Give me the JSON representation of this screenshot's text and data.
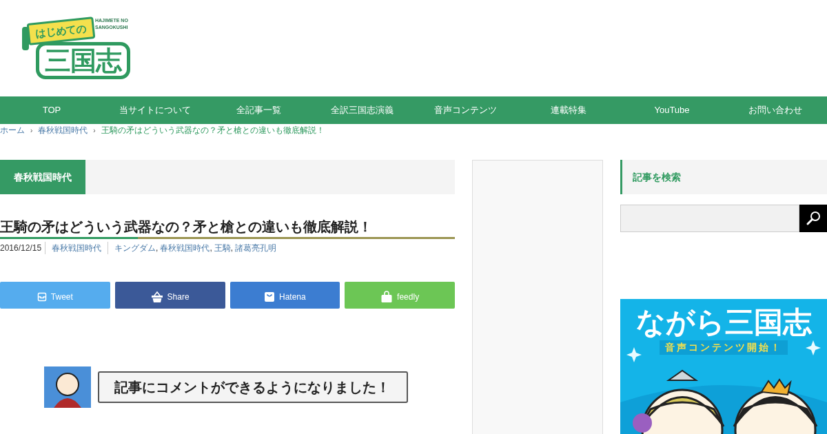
{
  "logo": {
    "banner": "はじめての",
    "main": "三国志",
    "romaji_1": "HAJIMETE NO",
    "romaji_2": "SANGOKUSHI"
  },
  "nav": [
    "TOP",
    "当サイトについて",
    "全記事一覧",
    "全訳三国志演義",
    "音声コンテンツ",
    "連載特集",
    "YouTube",
    "お問い合わせ"
  ],
  "breadcrumb_separator": "›",
  "breadcrumb": [
    {
      "label": "ホーム",
      "current": false
    },
    {
      "label": "春秋戦国時代",
      "current": false
    },
    {
      "label": "王騎の矛はどういう武器なの？矛と槍との違いも徹底解説！",
      "current": true
    }
  ],
  "category_heading": "春秋戦国時代",
  "article": {
    "title": "王騎の矛はどういう武器なの？矛と槍との違いも徹底解説！",
    "date": "2016/12/15",
    "category": "春秋戦国時代",
    "tags": [
      "キングダム",
      "春秋戦国時代",
      "王騎",
      "諸葛亮孔明"
    ],
    "tag_separator": ","
  },
  "share_buttons": [
    {
      "label": "Tweet",
      "kind": "tweet",
      "color": "#55acee"
    },
    {
      "label": "Share",
      "kind": "share",
      "color": "#3b5998"
    },
    {
      "label": "Hatena",
      "kind": "hatena",
      "color": "#3c7dd1"
    },
    {
      "label": "feedly",
      "kind": "feedly",
      "color": "#6cc655"
    }
  ],
  "comment_banner": {
    "text": "記事にコメントができるようになりました！"
  },
  "sidebar": {
    "search_heading": "記事を検索",
    "promo": {
      "title": "ながら三国志",
      "subtitle": "音声コンテンツ開始！"
    }
  }
}
